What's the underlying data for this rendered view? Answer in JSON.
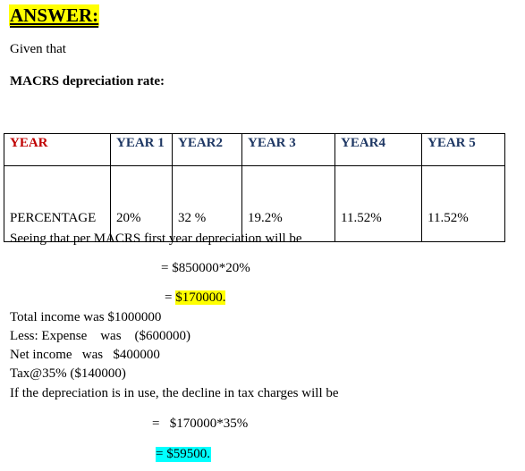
{
  "heading": "ANSWER:",
  "intro": "Given that",
  "section_title": "MACRS depreciation rate:",
  "table": {
    "header": [
      "YEAR",
      "YEAR 1",
      "YEAR2",
      "YEAR 3",
      "YEAR4",
      "YEAR 5"
    ],
    "row": [
      "PERCENTAGE",
      "20%",
      "32 %",
      "19.2%",
      "11.52%",
      "11.52%"
    ]
  },
  "lines": {
    "seeing": "Seeing that per MACRS first year depreciation will be",
    "calc1": "= $850000*20%",
    "calc2_prefix": "= ",
    "calc2_result": "$170000.",
    "total_income": "Total income was $1000000",
    "less_expense": "Less: Expense    was    ($600000)",
    "net_income": "Net income   was   $400000",
    "tax": "Tax@35% ($140000)",
    "if_dep": "If the depreciation is in use, the decline in tax charges will be",
    "calc3": "=   $170000*35%",
    "calc4": "= $59500."
  },
  "colors": {
    "highlight_yellow": "#ffff00",
    "highlight_cyan": "#00ffff",
    "header_red": "#c00000",
    "header_blue": "#1f3864"
  }
}
